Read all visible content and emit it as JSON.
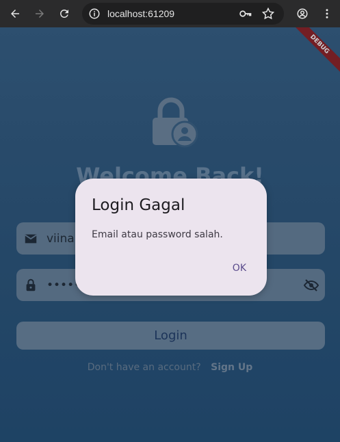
{
  "browser": {
    "url": "localhost:61209"
  },
  "app": {
    "debug_label": "DEBUG",
    "welcome_text": "Welcome Back!",
    "email_value": "viina",
    "password_mask": "•••••••",
    "login_label": "Login",
    "signup_prompt": "Don't have an account?",
    "signup_link": "Sign Up"
  },
  "dialog": {
    "title": "Login Gagal",
    "message": "Email atau password salah.",
    "ok_label": "OK"
  },
  "colors": {
    "accent": "#5a4b8c",
    "dialog_bg": "#ece4ee",
    "debug_banner": "#8f1e22"
  }
}
